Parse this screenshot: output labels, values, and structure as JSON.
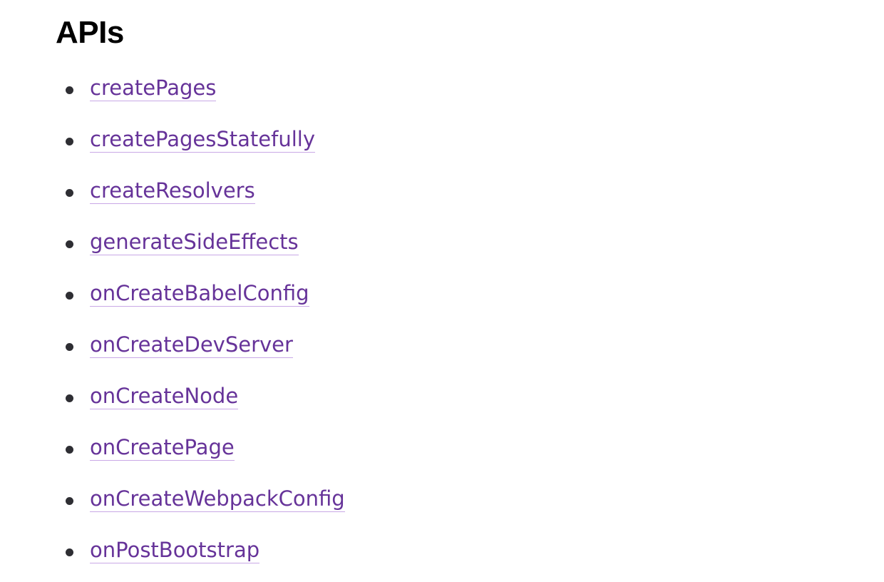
{
  "heading": "APIs",
  "colors": {
    "link": "#663399",
    "link_underline": "#c9a8e6",
    "bullet": "#2e2e33",
    "heading": "#000000"
  },
  "apis": [
    {
      "label": "createPages"
    },
    {
      "label": "createPagesStatefully"
    },
    {
      "label": "createResolvers"
    },
    {
      "label": "generateSideEffects"
    },
    {
      "label": "onCreateBabelConfig"
    },
    {
      "label": "onCreateDevServer"
    },
    {
      "label": "onCreateNode"
    },
    {
      "label": "onCreatePage"
    },
    {
      "label": "onCreateWebpackConfig"
    },
    {
      "label": "onPostBootstrap"
    }
  ]
}
